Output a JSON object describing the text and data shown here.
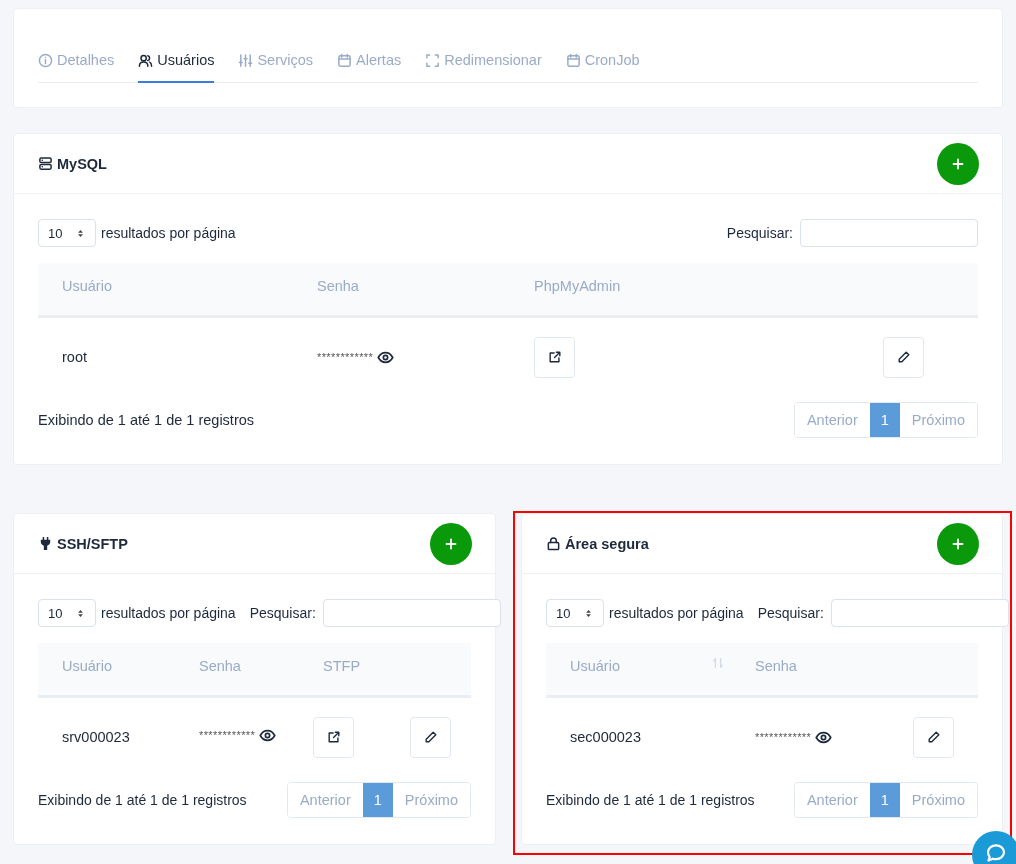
{
  "tabs": [
    {
      "label": "Detalhes",
      "selected": false
    },
    {
      "label": "Usuários",
      "selected": true
    },
    {
      "label": "Serviços",
      "selected": false
    },
    {
      "label": "Alertas",
      "selected": false
    },
    {
      "label": "Redimensionar",
      "selected": false
    },
    {
      "label": "CronJob",
      "selected": false
    }
  ],
  "cards": [
    {
      "title": "MySQL",
      "page_size": "10",
      "per_page_label": "resultados por página",
      "search_label": "Pesquisar:",
      "columns": [
        {
          "label": "Usuário",
          "sortable": false
        },
        {
          "label": "Senha",
          "sortable": false
        },
        {
          "label": "PhpMyAdmin",
          "sortable": false
        }
      ],
      "rows": [
        [
          {
            "kind": "text",
            "text": "root"
          },
          {
            "kind": "password",
            "text": "************"
          },
          {
            "kind": "link"
          },
          {
            "kind": "edit"
          }
        ]
      ],
      "info": "Exibindo de 1 até 1 de 1 registros",
      "pagination": [
        {
          "label": "Anterior",
          "selected": false
        },
        {
          "label": "1",
          "selected": true
        },
        {
          "label": "Próximo",
          "selected": false
        }
      ]
    },
    {
      "title": "SSH/SFTP",
      "page_size": "10",
      "per_page_label": "resultados por página",
      "search_label": "Pesquisar:",
      "columns": [
        {
          "label": "Usuário",
          "sortable": false
        },
        {
          "label": "Senha",
          "sortable": false
        },
        {
          "label": "STFP",
          "sortable": false
        }
      ],
      "rows": [
        [
          {
            "kind": "text",
            "text": "srv000023"
          },
          {
            "kind": "password",
            "text": "************"
          },
          {
            "kind": "link"
          },
          {
            "kind": "edit"
          }
        ]
      ],
      "info": "Exibindo de 1 até 1 de 1 registros",
      "pagination": [
        {
          "label": "Anterior",
          "selected": false
        },
        {
          "label": "1",
          "selected": true
        },
        {
          "label": "Próximo",
          "selected": false
        }
      ]
    },
    {
      "title": "Área segura",
      "page_size": "10",
      "per_page_label": "resultados por página",
      "search_label": "Pesquisar:",
      "columns": [
        {
          "label": "Usuário",
          "sortable": true
        },
        {
          "label": "Senha",
          "sortable": false
        }
      ],
      "rows": [
        [
          {
            "kind": "text",
            "text": "sec000023"
          },
          {
            "kind": "password",
            "text": "************"
          },
          {
            "kind": "edit"
          }
        ]
      ],
      "info": "Exibindo de 1 até 1 de 1 registros",
      "pagination": [
        {
          "label": "Anterior",
          "selected": false
        },
        {
          "label": "1",
          "selected": true
        },
        {
          "label": "Próximo",
          "selected": false
        }
      ]
    }
  ]
}
